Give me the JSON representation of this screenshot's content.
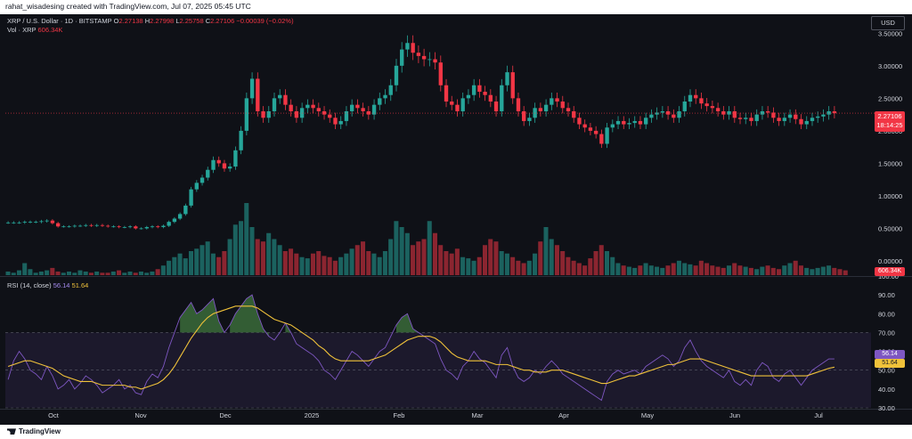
{
  "header": {
    "credit": "rahat_wisadesing created with TradingView.com, Jul 07, 2025 05:45 UTC",
    "symbol": "XRP / U.S. Dollar · 1D · BITSTAMP",
    "ohlc": {
      "o_label": "O",
      "o": "2.27138",
      "h_label": "H",
      "h": "2.27998",
      "l_label": "L",
      "l": "2.25758",
      "c_label": "C",
      "c": "2.27106",
      "change": "−0.00039 (−0.02%)"
    },
    "vol_label": "Vol · XRP",
    "vol_value": "606.34K"
  },
  "currency_button": "USD",
  "last_price": {
    "value": "2.27106",
    "countdown": "18:14:25"
  },
  "volume_tag": "606.34K",
  "rsi": {
    "label": "RSI (14, close)",
    "value": "56.14",
    "ma_value": "51.64"
  },
  "footer": {
    "brand": "TradingView"
  },
  "colors": {
    "up": "#26a69a",
    "down": "#f23645",
    "rsi_line": "#7e57c2",
    "rsi_ma": "#f0c23a",
    "rsi_band": "rgba(126,87,194,0.12)",
    "overbought_fill": "#3a6b3a"
  },
  "chart_data": [
    {
      "type": "candlestick",
      "title": "XRP / U.S. Dollar · 1D · BITSTAMP",
      "x_ticks": [
        "Oct",
        "Nov",
        "Dec",
        "2025",
        "Feb",
        "Mar",
        "Apr",
        "May",
        "Jun",
        "Jul"
      ],
      "y_ticks": [
        "0.00000",
        "0.50000",
        "1.00000",
        "1.50000",
        "2.00000",
        "2.50000",
        "3.00000",
        "3.50000"
      ],
      "ylim": [
        0,
        3.6
      ],
      "last_value": 2.27106,
      "close_path": [
        0.59,
        0.59,
        0.59,
        0.6,
        0.6,
        0.6,
        0.61,
        0.62,
        0.58,
        0.53,
        0.53,
        0.53,
        0.54,
        0.54,
        0.55,
        0.54,
        0.55,
        0.54,
        0.53,
        0.53,
        0.52,
        0.52,
        0.53,
        0.5,
        0.5,
        0.52,
        0.53,
        0.52,
        0.54,
        0.6,
        0.65,
        0.72,
        0.85,
        1.1,
        1.2,
        1.28,
        1.4,
        1.55,
        1.5,
        1.42,
        1.45,
        1.7,
        2.0,
        2.5,
        2.8,
        2.3,
        2.2,
        2.3,
        2.5,
        2.55,
        2.4,
        2.3,
        2.2,
        2.35,
        2.4,
        2.35,
        2.3,
        2.25,
        2.2,
        2.1,
        2.15,
        2.3,
        2.4,
        2.35,
        2.3,
        2.25,
        2.4,
        2.5,
        2.55,
        2.7,
        3.0,
        3.25,
        3.35,
        3.2,
        3.15,
        3.1,
        3.1,
        3.05,
        2.7,
        2.45,
        2.4,
        2.3,
        2.5,
        2.55,
        2.7,
        2.6,
        2.55,
        2.45,
        2.3,
        2.7,
        2.9,
        2.5,
        2.3,
        2.15,
        2.2,
        2.35,
        2.3,
        2.4,
        2.5,
        2.45,
        2.35,
        2.3,
        2.2,
        2.1,
        2.05,
        2.0,
        1.95,
        1.8,
        2.05,
        2.1,
        2.15,
        2.1,
        2.12,
        2.15,
        2.1,
        2.2,
        2.25,
        2.28,
        2.3,
        2.25,
        2.2,
        2.3,
        2.45,
        2.55,
        2.5,
        2.42,
        2.38,
        2.35,
        2.3,
        2.25,
        2.3,
        2.2,
        2.18,
        2.2,
        2.15,
        2.25,
        2.3,
        2.28,
        2.2,
        2.15,
        2.2,
        2.25,
        2.18,
        2.1,
        2.15,
        2.2,
        2.22,
        2.25,
        2.3,
        2.27
      ],
      "volume_path": [
        3,
        2,
        4,
        10,
        5,
        2,
        3,
        4,
        6,
        3,
        2,
        3,
        2,
        4,
        3,
        2,
        3,
        2,
        2,
        3,
        4,
        2,
        3,
        2,
        3,
        2,
        3,
        5,
        8,
        12,
        15,
        18,
        14,
        20,
        22,
        25,
        28,
        18,
        15,
        20,
        30,
        42,
        45,
        60,
        40,
        30,
        28,
        35,
        30,
        25,
        20,
        22,
        18,
        15,
        14,
        18,
        20,
        16,
        15,
        12,
        15,
        18,
        22,
        25,
        28,
        20,
        18,
        15,
        20,
        30,
        45,
        40,
        35,
        25,
        28,
        30,
        45,
        35,
        25,
        20,
        18,
        22,
        15,
        14,
        12,
        15,
        25,
        30,
        28,
        20,
        18,
        15,
        12,
        10,
        12,
        18,
        28,
        40,
        30,
        25,
        20,
        15,
        12,
        10,
        8,
        14,
        20,
        25,
        20,
        15,
        10,
        8,
        7,
        6,
        8,
        10,
        8,
        7,
        6,
        8,
        10,
        12,
        10,
        9,
        8,
        12,
        10,
        8,
        7,
        6,
        8,
        10,
        8,
        7,
        6,
        5,
        7,
        8,
        6,
        5,
        8,
        10,
        12,
        8,
        6,
        5,
        6,
        7,
        8,
        6,
        5,
        4
      ]
    },
    {
      "type": "line",
      "title": "RSI (14, close)",
      "y_ticks": [
        "30.00",
        "40.00",
        "50.00",
        "60.00",
        "70.00",
        "80.00",
        "90.00",
        "100.00"
      ],
      "ylim": [
        30,
        100
      ],
      "band": [
        30,
        70
      ],
      "series": [
        {
          "name": "RSI",
          "last": 56.14,
          "values": [
            45,
            55,
            60,
            56,
            50,
            48,
            45,
            52,
            47,
            40,
            42,
            45,
            40,
            43,
            47,
            45,
            42,
            38,
            40,
            42,
            45,
            40,
            42,
            38,
            37,
            44,
            48,
            46,
            52,
            62,
            70,
            78,
            82,
            86,
            80,
            82,
            85,
            88,
            76,
            70,
            74,
            80,
            84,
            88,
            90,
            80,
            72,
            68,
            66,
            70,
            75,
            70,
            64,
            62,
            60,
            58,
            55,
            50,
            48,
            45,
            50,
            55,
            60,
            58,
            55,
            52,
            56,
            60,
            62,
            68,
            74,
            78,
            80,
            72,
            70,
            68,
            66,
            64,
            56,
            50,
            48,
            45,
            52,
            55,
            60,
            56,
            54,
            50,
            46,
            58,
            62,
            52,
            46,
            44,
            46,
            50,
            48,
            52,
            55,
            52,
            48,
            46,
            44,
            42,
            40,
            38,
            36,
            34,
            44,
            48,
            50,
            48,
            49,
            50,
            48,
            52,
            54,
            56,
            58,
            56,
            52,
            55,
            62,
            66,
            60,
            55,
            52,
            50,
            48,
            46,
            50,
            44,
            42,
            45,
            42,
            50,
            54,
            52,
            46,
            44,
            48,
            50,
            46,
            42,
            46,
            50,
            52,
            54,
            56,
            56
          ]
        },
        {
          "name": "RSI MA",
          "last": 51.64,
          "values": [
            52,
            53,
            54,
            55,
            55,
            54,
            53,
            52,
            51,
            49,
            47,
            46,
            45,
            44,
            44,
            44,
            43,
            42,
            42,
            42,
            42,
            42,
            41,
            41,
            40,
            41,
            42,
            43,
            45,
            48,
            52,
            57,
            62,
            67,
            71,
            75,
            78,
            80,
            81,
            82,
            83,
            84,
            84,
            84,
            84,
            83,
            81,
            79,
            77,
            76,
            75,
            74,
            72,
            70,
            68,
            66,
            63,
            61,
            58,
            56,
            55,
            55,
            55,
            55,
            55,
            55,
            56,
            57,
            58,
            60,
            62,
            64,
            66,
            67,
            68,
            68,
            68,
            67,
            65,
            62,
            59,
            57,
            56,
            55,
            55,
            55,
            55,
            54,
            53,
            53,
            53,
            52,
            51,
            50,
            50,
            49,
            49,
            49,
            50,
            50,
            50,
            49,
            48,
            47,
            46,
            45,
            44,
            43,
            43,
            44,
            45,
            46,
            47,
            47,
            48,
            49,
            50,
            51,
            52,
            53,
            53,
            54,
            55,
            56,
            56,
            56,
            55,
            54,
            53,
            52,
            51,
            50,
            49,
            48,
            47,
            47,
            47,
            47,
            47,
            47,
            47,
            47,
            47,
            47,
            47,
            48,
            49,
            50,
            51,
            51.6
          ]
        }
      ]
    }
  ]
}
